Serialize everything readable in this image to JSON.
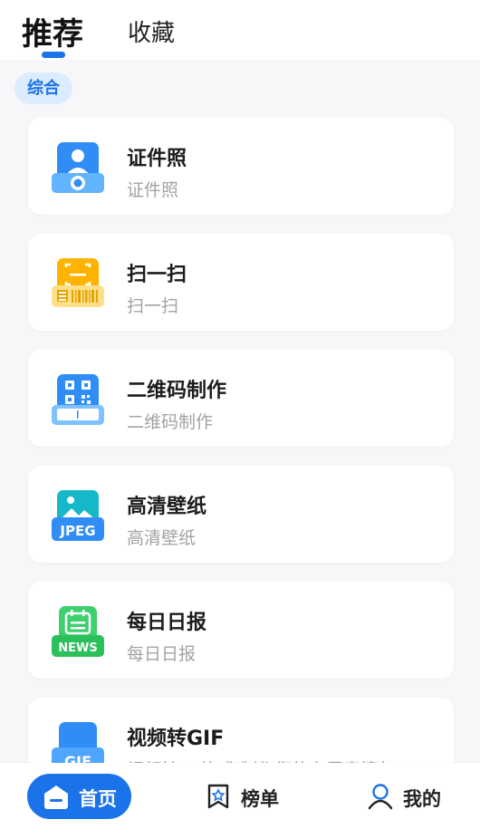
{
  "header": {
    "tabs": [
      {
        "label": "推荐",
        "active": true
      },
      {
        "label": "收藏",
        "active": false
      }
    ]
  },
  "category_chip": "综合",
  "tools": [
    {
      "title": "证件照",
      "subtitle": "证件照",
      "icon": "id-photo-icon"
    },
    {
      "title": "扫一扫",
      "subtitle": "扫一扫",
      "icon": "scan-icon"
    },
    {
      "title": "二维码制作",
      "subtitle": "二维码制作",
      "icon": "qr-code-icon"
    },
    {
      "title": "高清壁纸",
      "subtitle": "高清壁纸",
      "icon": "wallpaper-jpeg-icon"
    },
    {
      "title": "每日日报",
      "subtitle": "每日日报",
      "icon": "news-icon"
    },
    {
      "title": "视频转GIF",
      "subtitle": "视频转gif格式,制作您的专属表情包",
      "icon": "gif-icon"
    }
  ],
  "icon_labels": {
    "jpeg": "JPEG",
    "news": "NEWS",
    "gif": "GIF"
  },
  "bottom_nav": [
    {
      "label": "首页",
      "icon": "home-icon",
      "active": true
    },
    {
      "label": "榜单",
      "icon": "ranking-bookmark-icon",
      "active": false
    },
    {
      "label": "我的",
      "icon": "profile-icon",
      "active": false
    }
  ],
  "colors": {
    "accent": "#1a73e8",
    "chip_bg": "#dcecff",
    "background": "#f7f7f9"
  }
}
